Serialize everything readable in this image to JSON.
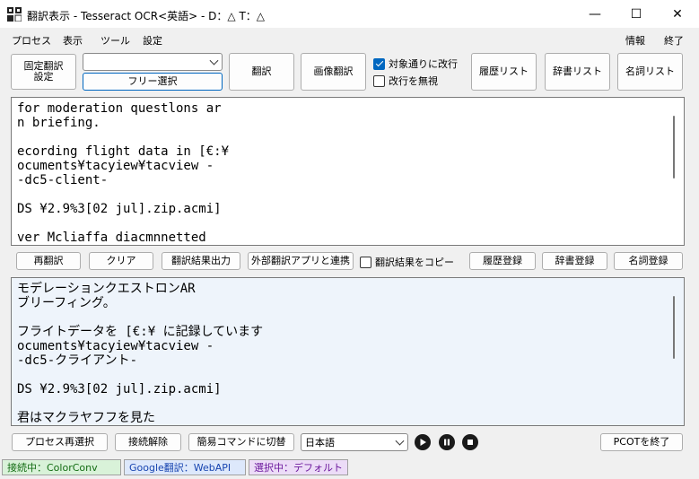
{
  "window": {
    "title": "翻訳表示 - Tesseract OCR<英語> - D：△ T：△",
    "minimize_glyph": "—",
    "maximize_glyph": "☐",
    "close_glyph": "✕"
  },
  "menu": {
    "process": "プロセス",
    "view": "表示",
    "tools": "ツール",
    "settings": "設定",
    "info": "情報",
    "exit": "終了"
  },
  "toolbar": {
    "fixed_setting_line1": "固定翻訳",
    "fixed_setting_line2": "設定",
    "select_value": "",
    "free_select": "フリー選択",
    "translate": "翻訳",
    "image_translate": "画像翻訳",
    "wrap_as_target": "対象通りに改行",
    "wrap_as_target_checked": true,
    "ignore_newline": "改行を無視",
    "ignore_newline_checked": false,
    "history_list": "履歴リスト",
    "dictionary_list": "辞書リスト",
    "noun_list": "名詞リスト"
  },
  "source_text": {
    "lines": [
      "for moderation questlons ar",
      "n briefing.",
      "",
      "ecording flight data in [€:¥",
      "ocuments¥tacyiew¥tacview -",
      "-dc5-client-",
      "",
      "DS ¥2.9%3[02 jul].zip.acmi]",
      "",
      "ver Mcliaffa diacmnnetted"
    ]
  },
  "midbar": {
    "retranslate": "再翻訳",
    "clear": "クリア",
    "output_result": "翻訳結果出力",
    "external_link": "外部翻訳アプリと連携",
    "copy_result": "翻訳結果をコピー",
    "copy_result_checked": false,
    "register_history": "履歴登録",
    "register_dictionary": "辞書登録",
    "register_noun": "名詞登録"
  },
  "translated_text": {
    "lines": [
      "モデレーションクエストロンAR",
      "ブリーフィング。",
      "",
      "フライトデータを [€:¥ に記録しています",
      "ocuments¥tacyiew¥tacview -",
      "-dc5-クライアント-",
      "",
      "DS ¥2.9%3[02 jul].zip.acmi]",
      "",
      "君はマクラヤフフを見た"
    ]
  },
  "bottombar": {
    "reselect_process": "プロセス再選択",
    "disconnect": "接続解除",
    "simple_command": "簡易コマンドに切替",
    "language": "日本語",
    "play_icon": "play-icon",
    "pause_icon": "pause-icon",
    "stop_icon": "stop-icon",
    "exit_pcot": "PCOTを終了"
  },
  "status": {
    "connected": "接続中：ColorConv",
    "google": "Google翻訳：WebAPI",
    "selected": "選択中：デフォルト",
    "connected_color": "#d9f2d9",
    "google_color": "#dde8fb",
    "selected_color": "#ecdcf7"
  }
}
